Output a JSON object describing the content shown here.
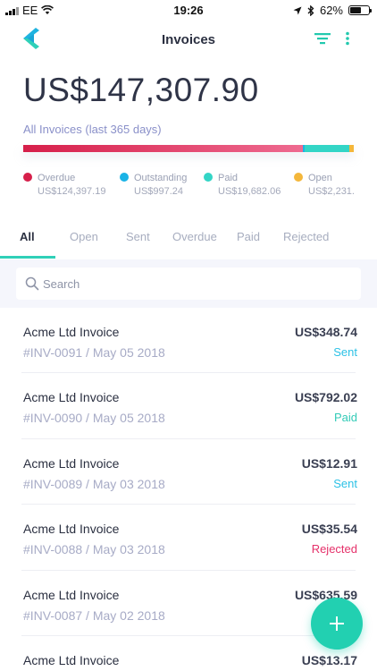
{
  "status_bar": {
    "carrier": "EE",
    "time": "19:26",
    "battery": "62%"
  },
  "header": {
    "title": "Invoices"
  },
  "summary": {
    "total": "US$147,307.90",
    "caption": "All Invoices (last 365 days)",
    "segments": [
      {
        "name": "Overdue",
        "value": "US$124,397.19",
        "color": "#d61f4a",
        "color_end": "#ee6a90",
        "fraction": 0.845
      },
      {
        "name": "Outstanding",
        "value": "US$997.24",
        "color": "#1ab3e6",
        "fraction": 0.007
      },
      {
        "name": "Paid",
        "value": "US$19,682.06",
        "color": "#33d5c6",
        "fraction": 0.134
      },
      {
        "name": "Open",
        "value": "US$2,231.",
        "color": "#f4b73b",
        "fraction": 0.014
      }
    ]
  },
  "tabs": [
    "All",
    "Open",
    "Sent",
    "Overdue",
    "Paid",
    "Rejected"
  ],
  "search": {
    "placeholder": "Search"
  },
  "invoices": [
    {
      "name": "Acme Ltd Invoice",
      "meta": "#INV-0091 / May 05 2018",
      "amount": "US$348.74",
      "status": "Sent",
      "status_color": "#2cc1e6"
    },
    {
      "name": "Acme Ltd Invoice",
      "meta": "#INV-0090 / May 05 2018",
      "amount": "US$792.02",
      "status": "Paid",
      "status_color": "#33cbb7"
    },
    {
      "name": "Acme Ltd Invoice",
      "meta": "#INV-0089 / May 03 2018",
      "amount": "US$12.91",
      "status": "Sent",
      "status_color": "#2cc1e6"
    },
    {
      "name": "Acme Ltd Invoice",
      "meta": "#INV-0088 / May 03 2018",
      "amount": "US$35.54",
      "status": "Rejected",
      "status_color": "#e5316a"
    },
    {
      "name": "Acme Ltd Invoice",
      "meta": "#INV-0087 / May 02 2018",
      "amount": "US$635.59",
      "status": "",
      "status_color": "#2cc1e6"
    },
    {
      "name": "Acme Ltd Invoice",
      "meta": "",
      "amount": "US$13.17",
      "status": "",
      "status_color": "#2cc1e6"
    }
  ],
  "colors": {
    "accent": "#22d0b1"
  },
  "icons": {
    "logo": "app-logo",
    "filter": "filter-icon",
    "more": "more-vertical-icon",
    "search": "search-icon",
    "add": "plus-icon"
  }
}
